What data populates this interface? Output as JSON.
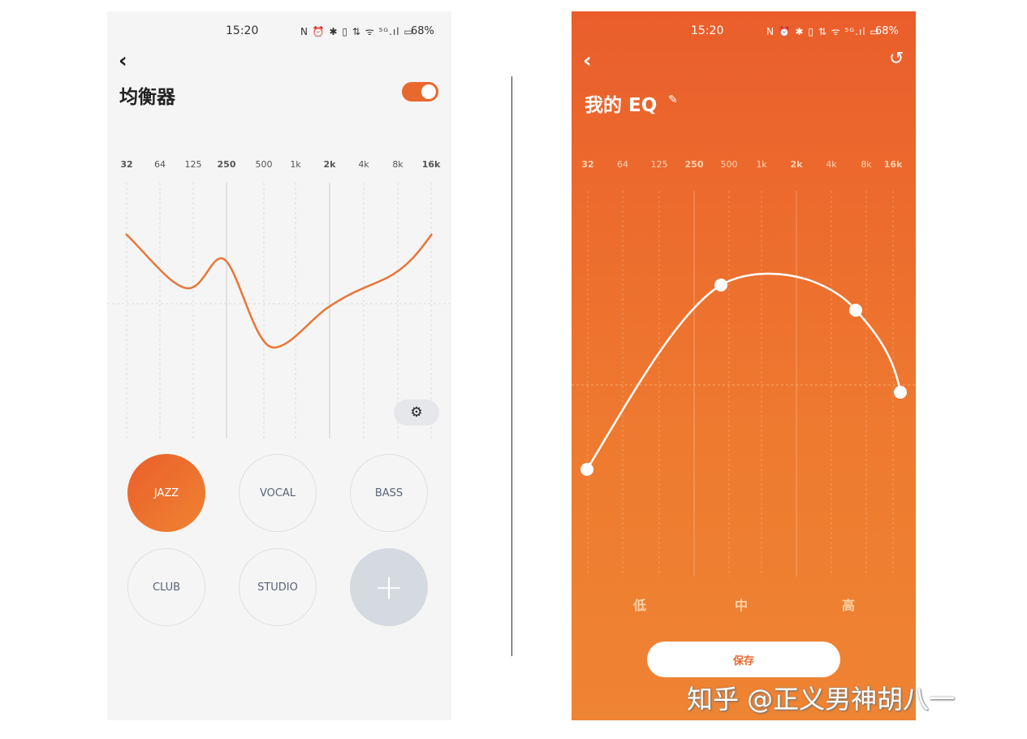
{
  "left": {
    "status": {
      "time": "15:20",
      "icons": "N ⏰ ✱ ▯ ⇅ ᯤ ⁵ᴳ.ıl ▭",
      "battery": "68%"
    },
    "title": "均衡器",
    "toggle_on": true,
    "frequencies": [
      "32",
      "64",
      "125",
      "250",
      "500",
      "1k",
      "2k",
      "4k",
      "8k",
      "16k"
    ],
    "presets": [
      "JAZZ",
      "VOCAL",
      "BASS",
      "CLUB",
      "STUDIO"
    ],
    "selected_preset": "JAZZ",
    "add_label": "+",
    "accent": "#e8692e"
  },
  "right": {
    "status": {
      "time": "15:20",
      "icons": "N ⏰ ✱ ▯ ⇅ ᯤ ⁵ᴳ.ıl ▭",
      "battery": "68%"
    },
    "title": "我的 EQ",
    "frequencies": [
      "32",
      "64",
      "125",
      "250",
      "500",
      "1k",
      "2k",
      "4k",
      "8k",
      "16k"
    ],
    "bands": [
      "低",
      "中",
      "高"
    ],
    "save_label": "保存"
  },
  "watermark": "知乎 @正义男神胡八一"
}
